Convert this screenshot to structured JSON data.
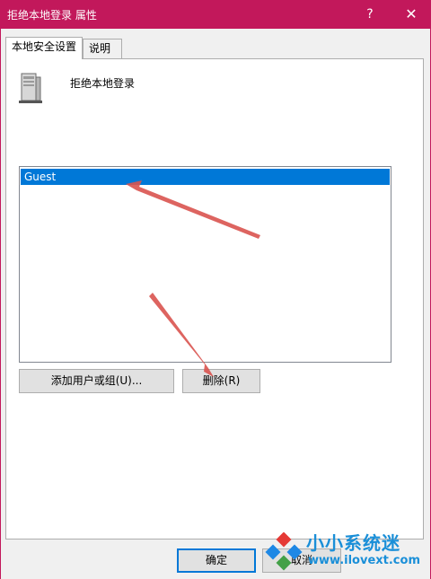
{
  "window": {
    "title": "拒绝本地登录 属性",
    "help_label": "?",
    "close_label": "✕"
  },
  "tabs": [
    {
      "label": "本地安全设置",
      "active": true
    },
    {
      "label": "说明",
      "active": false
    }
  ],
  "policy": {
    "icon": "server-icon",
    "name": "拒绝本地登录"
  },
  "accounts": {
    "items": [
      {
        "label": "Guest",
        "selected": true
      }
    ]
  },
  "buttons": {
    "add_label": "添加用户或组(U)...",
    "remove_label": "删除(R)",
    "ok_label": "确定",
    "cancel_label": "取消"
  },
  "watermark": {
    "title": "小小系统迷",
    "url": "www.ilovext.com"
  },
  "colors": {
    "titlebar": "#c2185b",
    "selection": "#0078d7",
    "annotation_arrow": "#d9534f",
    "watermark_text": "#1a8fd8"
  }
}
